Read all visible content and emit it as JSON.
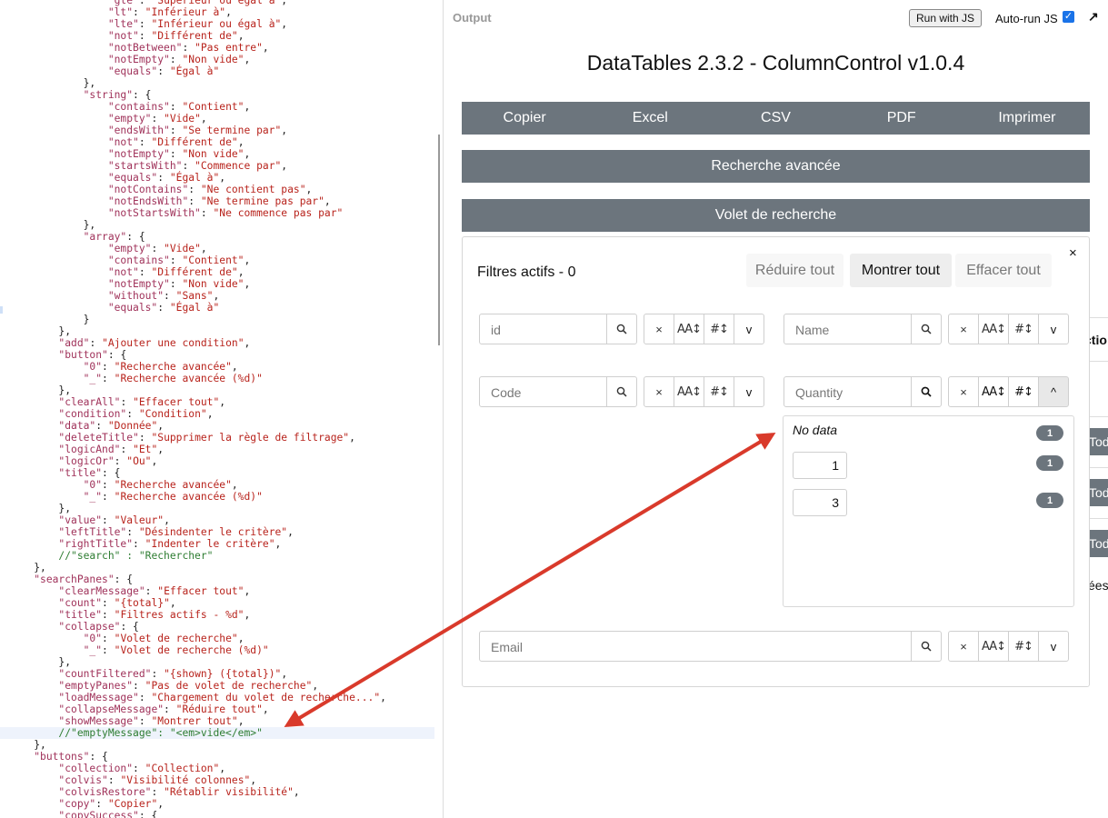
{
  "editor": {
    "lines": [
      {
        "t": "                \"gte\": \"Supérieur ou égal à\","
      },
      {
        "t": "                \"lt\": \"Inférieur à\","
      },
      {
        "t": "                \"lte\": \"Inférieur ou égal à\","
      },
      {
        "t": "                \"not\": \"Différent de\","
      },
      {
        "t": "                \"notBetween\": \"Pas entre\","
      },
      {
        "t": "                \"notEmpty\": \"Non vide\","
      },
      {
        "t": "                \"equals\": \"Égal à\""
      },
      {
        "t": "            },"
      },
      {
        "t": "            \"string\": {"
      },
      {
        "t": "                \"contains\": \"Contient\","
      },
      {
        "t": "                \"empty\": \"Vide\","
      },
      {
        "t": "                \"endsWith\": \"Se termine par\","
      },
      {
        "t": "                \"not\": \"Différent de\","
      },
      {
        "t": "                \"notEmpty\": \"Non vide\","
      },
      {
        "t": "                \"startsWith\": \"Commence par\","
      },
      {
        "t": "                \"equals\": \"Égal à\","
      },
      {
        "t": "                \"notContains\": \"Ne contient pas\","
      },
      {
        "t": "                \"notEndsWith\": \"Ne termine pas par\","
      },
      {
        "t": "                \"notStartsWith\": \"Ne commence pas par\""
      },
      {
        "t": "            },"
      },
      {
        "t": "            \"array\": {"
      },
      {
        "t": "                \"empty\": \"Vide\","
      },
      {
        "t": "                \"contains\": \"Contient\","
      },
      {
        "t": "                \"not\": \"Différent de\","
      },
      {
        "t": "                \"notEmpty\": \"Non vide\","
      },
      {
        "t": "                \"without\": \"Sans\","
      },
      {
        "t": "                \"equals\": \"Égal à\""
      },
      {
        "t": "            }"
      },
      {
        "t": "        },"
      },
      {
        "t": "        \"add\": \"Ajouter une condition\","
      },
      {
        "t": "        \"button\": {"
      },
      {
        "t": "            \"0\": \"Recherche avancée\","
      },
      {
        "t": "            \"_\": \"Recherche avancée (%d)\""
      },
      {
        "t": "        },"
      },
      {
        "t": "        \"clearAll\": \"Effacer tout\","
      },
      {
        "t": "        \"condition\": \"Condition\","
      },
      {
        "t": "        \"data\": \"Donnée\","
      },
      {
        "t": "        \"deleteTitle\": \"Supprimer la règle de filtrage\","
      },
      {
        "t": "        \"logicAnd\": \"Et\","
      },
      {
        "t": "        \"logicOr\": \"Ou\","
      },
      {
        "t": "        \"title\": {"
      },
      {
        "t": "            \"0\": \"Recherche avancée\","
      },
      {
        "t": "            \"_\": \"Recherche avancée (%d)\""
      },
      {
        "t": "        },"
      },
      {
        "t": "        \"value\": \"Valeur\","
      },
      {
        "t": "        \"leftTitle\": \"Désindenter le critère\","
      },
      {
        "t": "        \"rightTitle\": \"Indenter le critère\","
      },
      {
        "t": "        //\"search\" : \"Rechercher\"",
        "comment": true
      },
      {
        "t": "    },"
      },
      {
        "t": "    \"searchPanes\": {"
      },
      {
        "t": "        \"clearMessage\": \"Effacer tout\","
      },
      {
        "t": "        \"count\": \"{total}\","
      },
      {
        "t": "        \"title\": \"Filtres actifs - %d\","
      },
      {
        "t": "        \"collapse\": {"
      },
      {
        "t": "            \"0\": \"Volet de recherche\","
      },
      {
        "t": "            \"_\": \"Volet de recherche (%d)\""
      },
      {
        "t": "        },"
      },
      {
        "t": "        \"countFiltered\": \"{shown} ({total})\","
      },
      {
        "t": "        \"emptyPanes\": \"Pas de volet de recherche\","
      },
      {
        "t": "        \"loadMessage\": \"Chargement du volet de recherche...\","
      },
      {
        "t": "        \"collapseMessage\": \"Réduire tout\","
      },
      {
        "t": "        \"showMessage\": \"Montrer tout\","
      },
      {
        "t": "        //\"emptyMessage\": \"<em>vide</em>\"",
        "comment": true,
        "highlight": true
      },
      {
        "t": "    },"
      },
      {
        "t": "    \"buttons\": {"
      },
      {
        "t": "        \"collection\": \"Collection\","
      },
      {
        "t": "        \"colvis\": \"Visibilité colonnes\","
      },
      {
        "t": "        \"colvisRestore\": \"Rétablir visibilité\","
      },
      {
        "t": "        \"copy\": \"Copier\","
      },
      {
        "t": "        \"copySuccess\": {"
      }
    ]
  },
  "output": {
    "label": "Output",
    "run_button": "Run with JS",
    "autorun_label": "Auto-run JS",
    "autorun_checked": "✓",
    "expand_icon": "↗",
    "title": "DataTables 2.3.2 - ColumnControl v1.0.4",
    "export_buttons": [
      "Copier",
      "Excel",
      "CSV",
      "PDF",
      "Imprimer"
    ],
    "advanced_search": "Recherche avancée",
    "search_panes_button": "Volet de recherche",
    "behind": {
      "header_fragment": "ctio",
      "todo_label": "Todo",
      "footer_fragment": "ées"
    }
  },
  "panes": {
    "close": "×",
    "title": "Filtres actifs - 0",
    "reduce_all": "Réduire tout",
    "show_all": "Montrer tout",
    "clear_all": "Effacer tout",
    "fields": [
      {
        "placeholder": "id"
      },
      {
        "placeholder": "Name"
      },
      {
        "placeholder": "Code"
      },
      {
        "placeholder": "Quantity"
      },
      {
        "placeholder": "Email"
      }
    ],
    "controls": {
      "clear": "×",
      "sort_alpha": "AA↕",
      "sort_num": "#↕",
      "collapse": "v",
      "expand": "^"
    },
    "quantity_list": {
      "rows": [
        {
          "label": "No data",
          "count": "1"
        },
        {
          "label": "1",
          "count": "1"
        },
        {
          "label": "3",
          "count": "1"
        }
      ]
    }
  },
  "colors": {
    "button_gray": "#6c757d",
    "arrow_red": "#d93a2b",
    "checkbox_blue": "#1a73e8"
  }
}
